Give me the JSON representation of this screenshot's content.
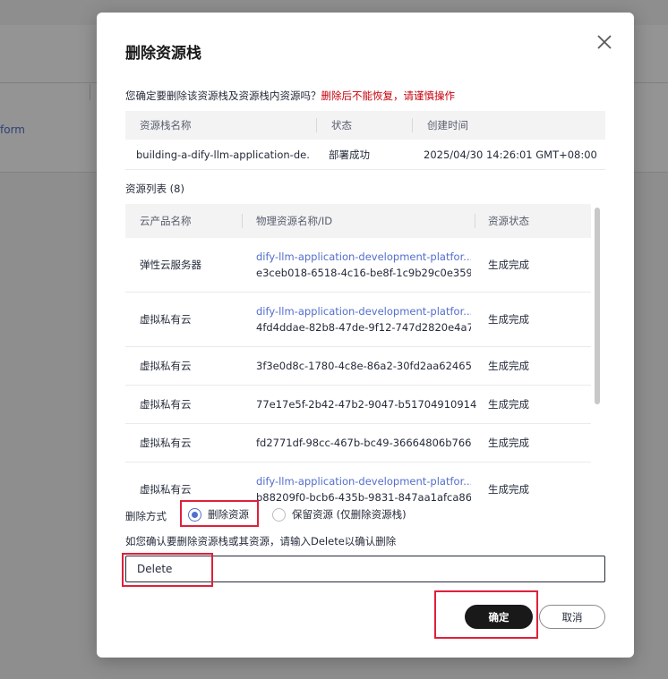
{
  "background": {
    "partial_link": "form"
  },
  "dialog": {
    "title": "删除资源栈",
    "confirm_question": "您确定要删除该资源栈及资源栈内资源吗？",
    "warning": "删除后不能恢复，请谨慎操作",
    "stack_table": {
      "headers": [
        "资源栈名称",
        "状态",
        "创建时间"
      ],
      "row": {
        "name": "building-a-dify-llm-application-de...",
        "status": "部署成功",
        "created": "2025/04/30 14:26:01 GMT+08:00"
      }
    },
    "resource_list_label": "资源列表 (8)",
    "resource_table": {
      "headers": [
        "云产品名称",
        "物理资源名称/ID",
        "资源状态"
      ],
      "rows": [
        {
          "product": "弹性云服务器",
          "name": "dify-llm-application-development-platfor...",
          "id": "e3ceb018-6518-4c16-be8f-1c9b29c0e359",
          "status": "生成完成"
        },
        {
          "product": "虚拟私有云",
          "name": "dify-llm-application-development-platfor...",
          "id": "4fd4ddae-82b8-47de-9f12-747d2820e4a7",
          "status": "生成完成"
        },
        {
          "product": "虚拟私有云",
          "id": "3f3e0d8c-1780-4c8e-86a2-30fd2aa62465",
          "status": "生成完成"
        },
        {
          "product": "虚拟私有云",
          "id": "77e17e5f-2b42-47b2-9047-b51704910914",
          "status": "生成完成"
        },
        {
          "product": "虚拟私有云",
          "id": "fd2771df-98cc-467b-bc49-36664806b766",
          "status": "生成完成"
        },
        {
          "product": "虚拟私有云",
          "name": "dify-llm-application-development-platfor...",
          "id": "b88209f0-bcb6-435b-9831-847aa1afca86",
          "status": "生成完成"
        }
      ]
    },
    "delete_mode": {
      "label": "删除方式",
      "option_delete": "删除资源",
      "option_keep": "保留资源 (仅删除资源栈)"
    },
    "confirm_hint": "如您确认要删除资源栈或其资源，请输入Delete以确认删除",
    "confirm_input_value": "Delete",
    "ok_label": "确定",
    "cancel_label": "取消"
  },
  "colors": {
    "accent": "#526ecc",
    "warning": "#c7000b",
    "annotation": "#e0203a",
    "primary_button": "#191919"
  }
}
